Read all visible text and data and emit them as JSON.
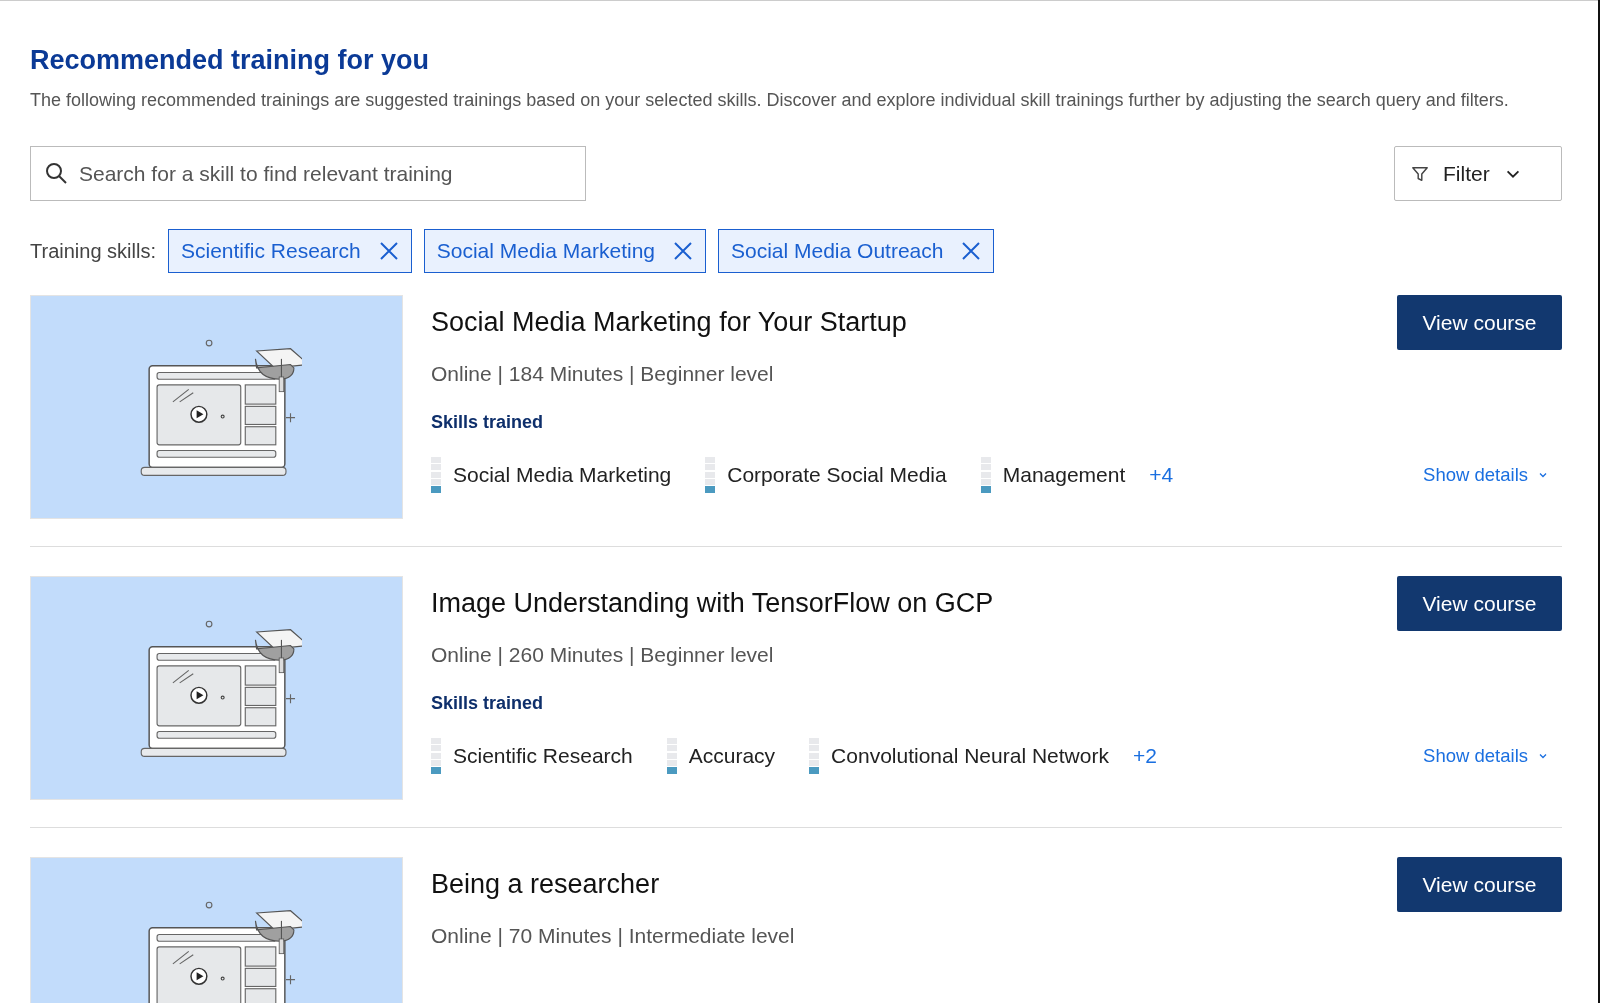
{
  "header": {
    "title": "Recommended training for you",
    "description": "The following recommended trainings are suggested trainings based on your selected skills. Discover and explore individual skill trainings further by adjusting the search query and filters."
  },
  "search": {
    "placeholder": "Search for a skill to find relevant training"
  },
  "filter": {
    "label": "Filter"
  },
  "training_skills": {
    "label": "Training skills:",
    "chips": [
      "Scientific Research",
      "Social Media Marketing",
      "Social Media Outreach"
    ]
  },
  "courses": [
    {
      "title": "Social Media Marketing for Your Startup",
      "meta": "Online | 184 Minutes | Beginner level",
      "button": "View course",
      "skills_heading": "Skills trained",
      "skills": [
        {
          "name": "Social Media Marketing",
          "level": 0.2
        },
        {
          "name": "Corporate Social Media",
          "level": 0.2
        },
        {
          "name": "Management",
          "level": 0.2
        }
      ],
      "more": "+4",
      "show_details": "Show details"
    },
    {
      "title": "Image Understanding with TensorFlow on GCP",
      "meta": "Online |  260 Minutes | Beginner level",
      "button": "View course",
      "skills_heading": "Skills trained",
      "skills": [
        {
          "name": "Scientific Research",
          "level": 0.2
        },
        {
          "name": "Accuracy",
          "level": 0.2
        },
        {
          "name": "Convolutional Neural Network",
          "level": 0.2
        }
      ],
      "more": "+2",
      "show_details": "Show details"
    },
    {
      "title": "Being a researcher",
      "meta": "Online | 70 Minutes | Intermediate level",
      "button": "View course"
    }
  ]
}
